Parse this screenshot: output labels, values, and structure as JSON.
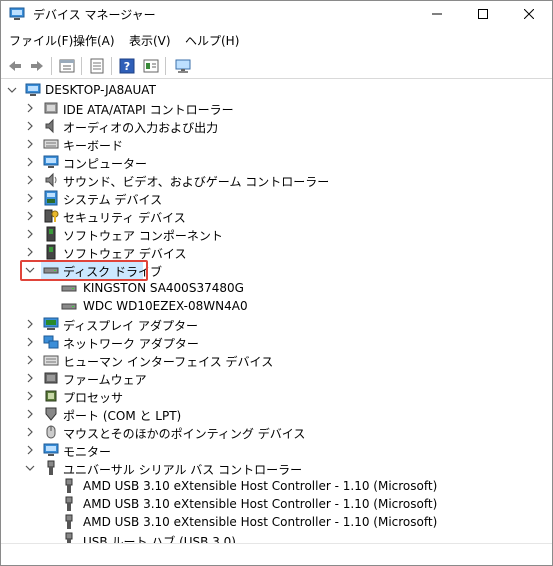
{
  "window": {
    "title": "デバイス マネージャー"
  },
  "menu": [
    "ファイル(F)",
    "操作(A)",
    "表示(V)",
    "ヘルプ(H)"
  ],
  "toolbar_icons": [
    "back-arrow-icon",
    "forward-arrow-icon",
    "properties-icon",
    "list-view-icon",
    "help-icon",
    "update-driver-icon",
    "scan-hardware-icon"
  ],
  "tree": {
    "root": "DESKTOP-JA8AUAT",
    "items": [
      {
        "label": "IDE ATA/ATAPI コントローラー",
        "icon": "ide-controller-icon"
      },
      {
        "label": "オーディオの入力および出力",
        "icon": "audio-io-icon"
      },
      {
        "label": "キーボード",
        "icon": "keyboard-icon"
      },
      {
        "label": "コンピューター",
        "icon": "computer-icon"
      },
      {
        "label": "サウンド、ビデオ、およびゲーム コントローラー",
        "icon": "sound-video-icon"
      },
      {
        "label": "システム デバイス",
        "icon": "system-device-icon"
      },
      {
        "label": "セキュリティ デバイス",
        "icon": "security-device-icon"
      },
      {
        "label": "ソフトウェア コンポーネント",
        "icon": "software-component-icon"
      },
      {
        "label": "ソフトウェア デバイス",
        "icon": "software-device-icon"
      },
      {
        "label": "ディスク ドライブ",
        "icon": "disk-drive-icon",
        "expanded": true,
        "selected": true
      },
      {
        "label": "KINGSTON SA400S37480G",
        "icon": "disk-icon",
        "child": true
      },
      {
        "label": "WDC WD10EZEX-08WN4A0",
        "icon": "disk-icon",
        "child": true
      },
      {
        "label": "ディスプレイ アダプター",
        "icon": "display-adapter-icon"
      },
      {
        "label": "ネットワーク アダプター",
        "icon": "network-adapter-icon"
      },
      {
        "label": "ヒューマン インターフェイス デバイス",
        "icon": "hid-icon"
      },
      {
        "label": "ファームウェア",
        "icon": "firmware-icon"
      },
      {
        "label": "プロセッサ",
        "icon": "processor-icon"
      },
      {
        "label": "ポート (COM と LPT)",
        "icon": "port-icon"
      },
      {
        "label": "マウスとそのほかのポインティング デバイス",
        "icon": "mouse-icon"
      },
      {
        "label": "モニター",
        "icon": "monitor-icon"
      },
      {
        "label": "ユニバーサル シリアル バス コントローラー",
        "icon": "usb-controller-icon",
        "expanded": true
      },
      {
        "label": "AMD USB 3.10 eXtensible Host Controller - 1.10 (Microsoft)",
        "icon": "usb-plug-icon",
        "child": true
      },
      {
        "label": "AMD USB 3.10 eXtensible Host Controller - 1.10 (Microsoft)",
        "icon": "usb-plug-icon",
        "child": true
      },
      {
        "label": "AMD USB 3.10 eXtensible Host Controller - 1.10 (Microsoft)",
        "icon": "usb-plug-icon",
        "child": true
      },
      {
        "label": "USB ルート ハブ (USB 3.0)",
        "icon": "usb-plug-icon",
        "child": true
      }
    ]
  },
  "colors": {
    "selection": "#cce8ff",
    "highlight_border": "#e0443a"
  }
}
